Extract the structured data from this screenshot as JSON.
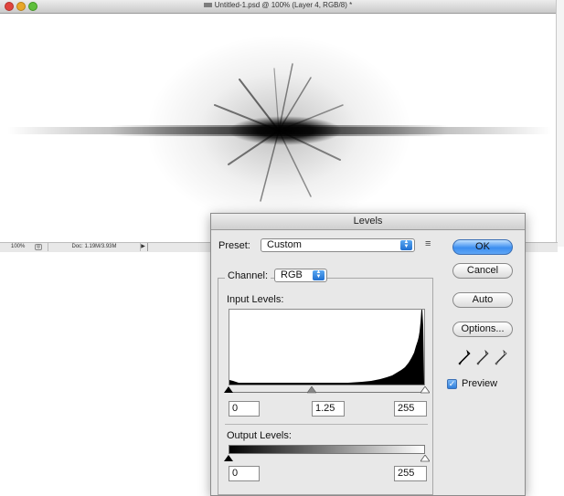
{
  "document": {
    "title": "Untitled-1.psd @ 100% (Layer 4, RGB/8) *",
    "status_zoom": "100%",
    "status_doc": "Doc: 1.19M/3.93M",
    "status_arrow": "▶"
  },
  "levels": {
    "title": "Levels",
    "preset_label": "Preset:",
    "preset_value": "Custom",
    "preset_menu_icon": "preset-options-icon",
    "channel_label": "Channel:",
    "channel_value": "RGB",
    "input_levels_label": "Input Levels:",
    "input_black": "0",
    "input_gamma": "1.25",
    "input_white": "255",
    "output_levels_label": "Output Levels:",
    "output_black": "0",
    "output_white": "255",
    "buttons": {
      "ok": "OK",
      "cancel": "Cancel",
      "auto": "Auto",
      "options": "Options..."
    },
    "preview_label": "Preview",
    "preview_checked": true,
    "eyedroppers": [
      "black-eyedropper-icon",
      "gray-eyedropper-icon",
      "white-eyedropper-icon"
    ]
  },
  "colors": {
    "accent": "#3c8ef0",
    "dialog_bg": "#e8e8e8"
  }
}
